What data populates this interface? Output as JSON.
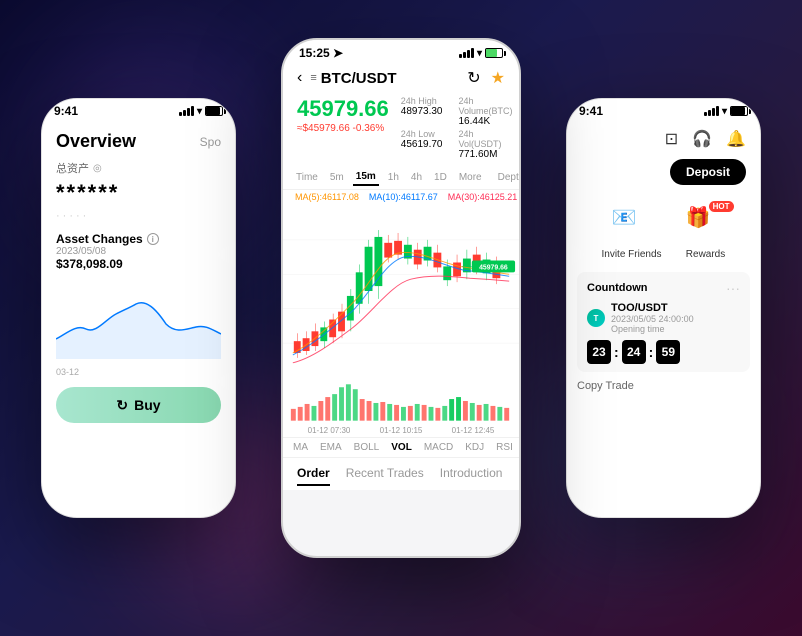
{
  "left_phone": {
    "status_time": "9:41",
    "overview_title": "Overview",
    "spot_tab": "Spo",
    "total_assets_label": "总资产",
    "stars_value": "******",
    "stars_sub": "·····",
    "asset_changes": "Asset Changes",
    "date": "2023/05/08",
    "amount": "$378,098.09",
    "date_axis": [
      "03-12"
    ],
    "buy_button": "Buy"
  },
  "center_phone": {
    "status_time": "15:25",
    "trading_pair": "BTC/USDT",
    "main_price": "45979.66",
    "price_eq": "≈$45979.66",
    "price_change": "-0.36%",
    "high_label": "24h High",
    "high_value": "48973.30",
    "volume_btc_label": "24h Volume(BTC)",
    "volume_btc_value": "16.44K",
    "low_label": "24h Low",
    "low_value": "45619.70",
    "volume_usdt_label": "24h Vol(USDT)",
    "volume_usdt_value": "771.60M",
    "time_tabs": [
      "Time",
      "5m",
      "15m",
      "1h",
      "4h",
      "1D",
      "More",
      "Depth"
    ],
    "active_tab": "15m",
    "ma5": "MA(5):46117.08",
    "ma10": "MA(10):46117.67",
    "ma30": "MA(30):46125.21",
    "price_badge": "45979.66",
    "time_labels": [
      "01-12 07:30",
      "01-12 10:15",
      "01-12 12:45"
    ],
    "indicator_tabs": [
      "MA",
      "EMA",
      "BOLL",
      "VOL",
      "MACD",
      "KDJ",
      "RSI"
    ],
    "active_indicator": "VOL",
    "order_tabs": [
      "Order",
      "Recent Trades",
      "Introduction"
    ],
    "active_order_tab": "Order"
  },
  "right_phone": {
    "status_time": "9:41",
    "deposit_label": "Deposit",
    "invite_friends_label": "Invite Friends",
    "rewards_label": "Rewards",
    "hot_badge": "HOT",
    "countdown_label": "Countdown",
    "token_name": "TOO/USDT",
    "token_date": "2023/05/05 24:00:00",
    "opening_time": "Opening time",
    "timer_h": "23",
    "timer_m": "24",
    "timer_s": "59",
    "copy_trade": "Copy Trade"
  }
}
